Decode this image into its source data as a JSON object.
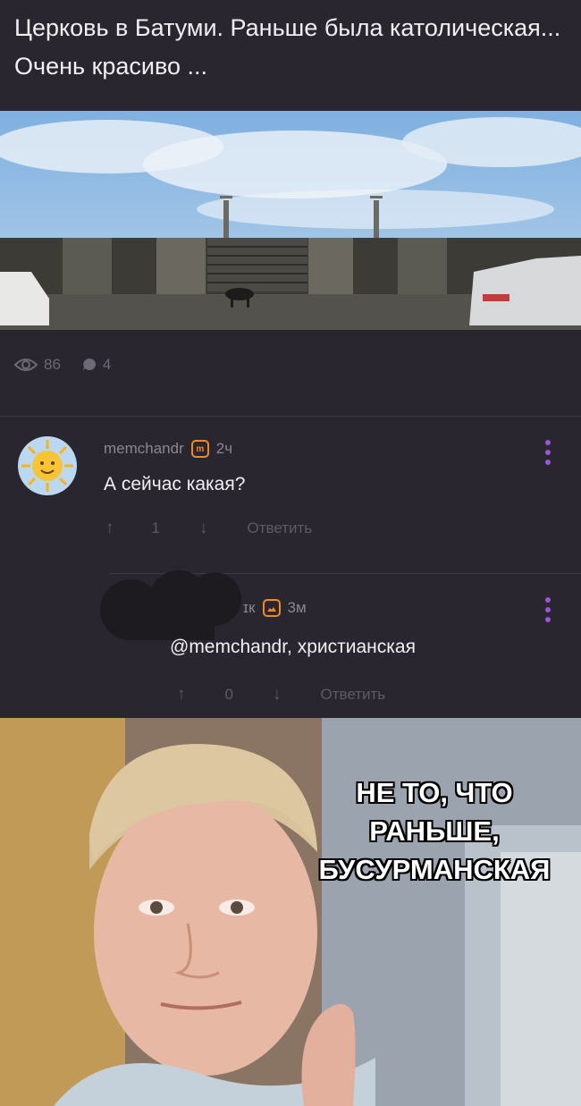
{
  "post": {
    "title": "Церковь в Батуми. Раньше была католическая... Очень красиво ...",
    "views": "86",
    "comments": "4"
  },
  "comments": [
    {
      "author": "memchandr",
      "badge_icon": "m-badge-icon",
      "time": "2ч",
      "text": "А сейчас какая?",
      "score": "1",
      "reply_label": "Ответить"
    },
    {
      "author": "ɪк",
      "badge_icon": "image-badge-icon",
      "time": "3м",
      "text": "@memchandr, христианская",
      "score": "0",
      "reply_label": "Ответить"
    }
  ],
  "meme": {
    "caption_line1": "НЕ ТО, ЧТО",
    "caption_line2": "РАНЬШЕ,",
    "caption_line3": "БУСУРМАНСКАЯ"
  },
  "colors": {
    "background": "#2a2630",
    "accent_purple": "#9a55d8",
    "badge_orange": "#f08a23"
  }
}
